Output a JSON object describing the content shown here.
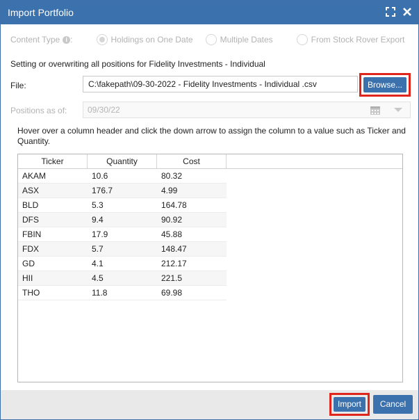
{
  "window": {
    "title": "Import Portfolio",
    "icons": [
      "expand-icon",
      "close-icon"
    ]
  },
  "content_type": {
    "label": "Content Type",
    "options": [
      {
        "label": "Holdings on One Date",
        "checked": true
      },
      {
        "label": "Multiple Dates",
        "checked": false
      },
      {
        "label": "From Stock Rover Export",
        "checked": false
      }
    ]
  },
  "message": "Setting or overwriting all positions for Fidelity Investments - Individual",
  "file": {
    "label": "File:",
    "value": "C:\\fakepath\\09-30-2022 - Fidelity Investments - Individual .csv",
    "browse_label": "Browse..."
  },
  "positions": {
    "label": "Positions as of:",
    "value": "09/30/22"
  },
  "hint": "Hover over a column header and click the down arrow to assign the column to a value such as Ticker and Quantity.",
  "table": {
    "columns": [
      "Ticker",
      "Quantity",
      "Cost"
    ],
    "rows": [
      [
        "AKAM",
        "10.6",
        "80.32"
      ],
      [
        "ASX",
        "176.7",
        "4.99"
      ],
      [
        "BLD",
        "5.3",
        "164.78"
      ],
      [
        "DFS",
        "9.4",
        "90.92"
      ],
      [
        "FBIN",
        "17.9",
        "45.88"
      ],
      [
        "FDX",
        "5.7",
        "148.47"
      ],
      [
        "GD",
        "4.1",
        "212.17"
      ],
      [
        "HII",
        "4.5",
        "221.5"
      ],
      [
        "THO",
        "11.8",
        "69.98"
      ]
    ]
  },
  "footer": {
    "import_label": "Import",
    "cancel_label": "Cancel"
  },
  "colors": {
    "accent": "#3b72ad",
    "highlight": "#e0261c"
  }
}
